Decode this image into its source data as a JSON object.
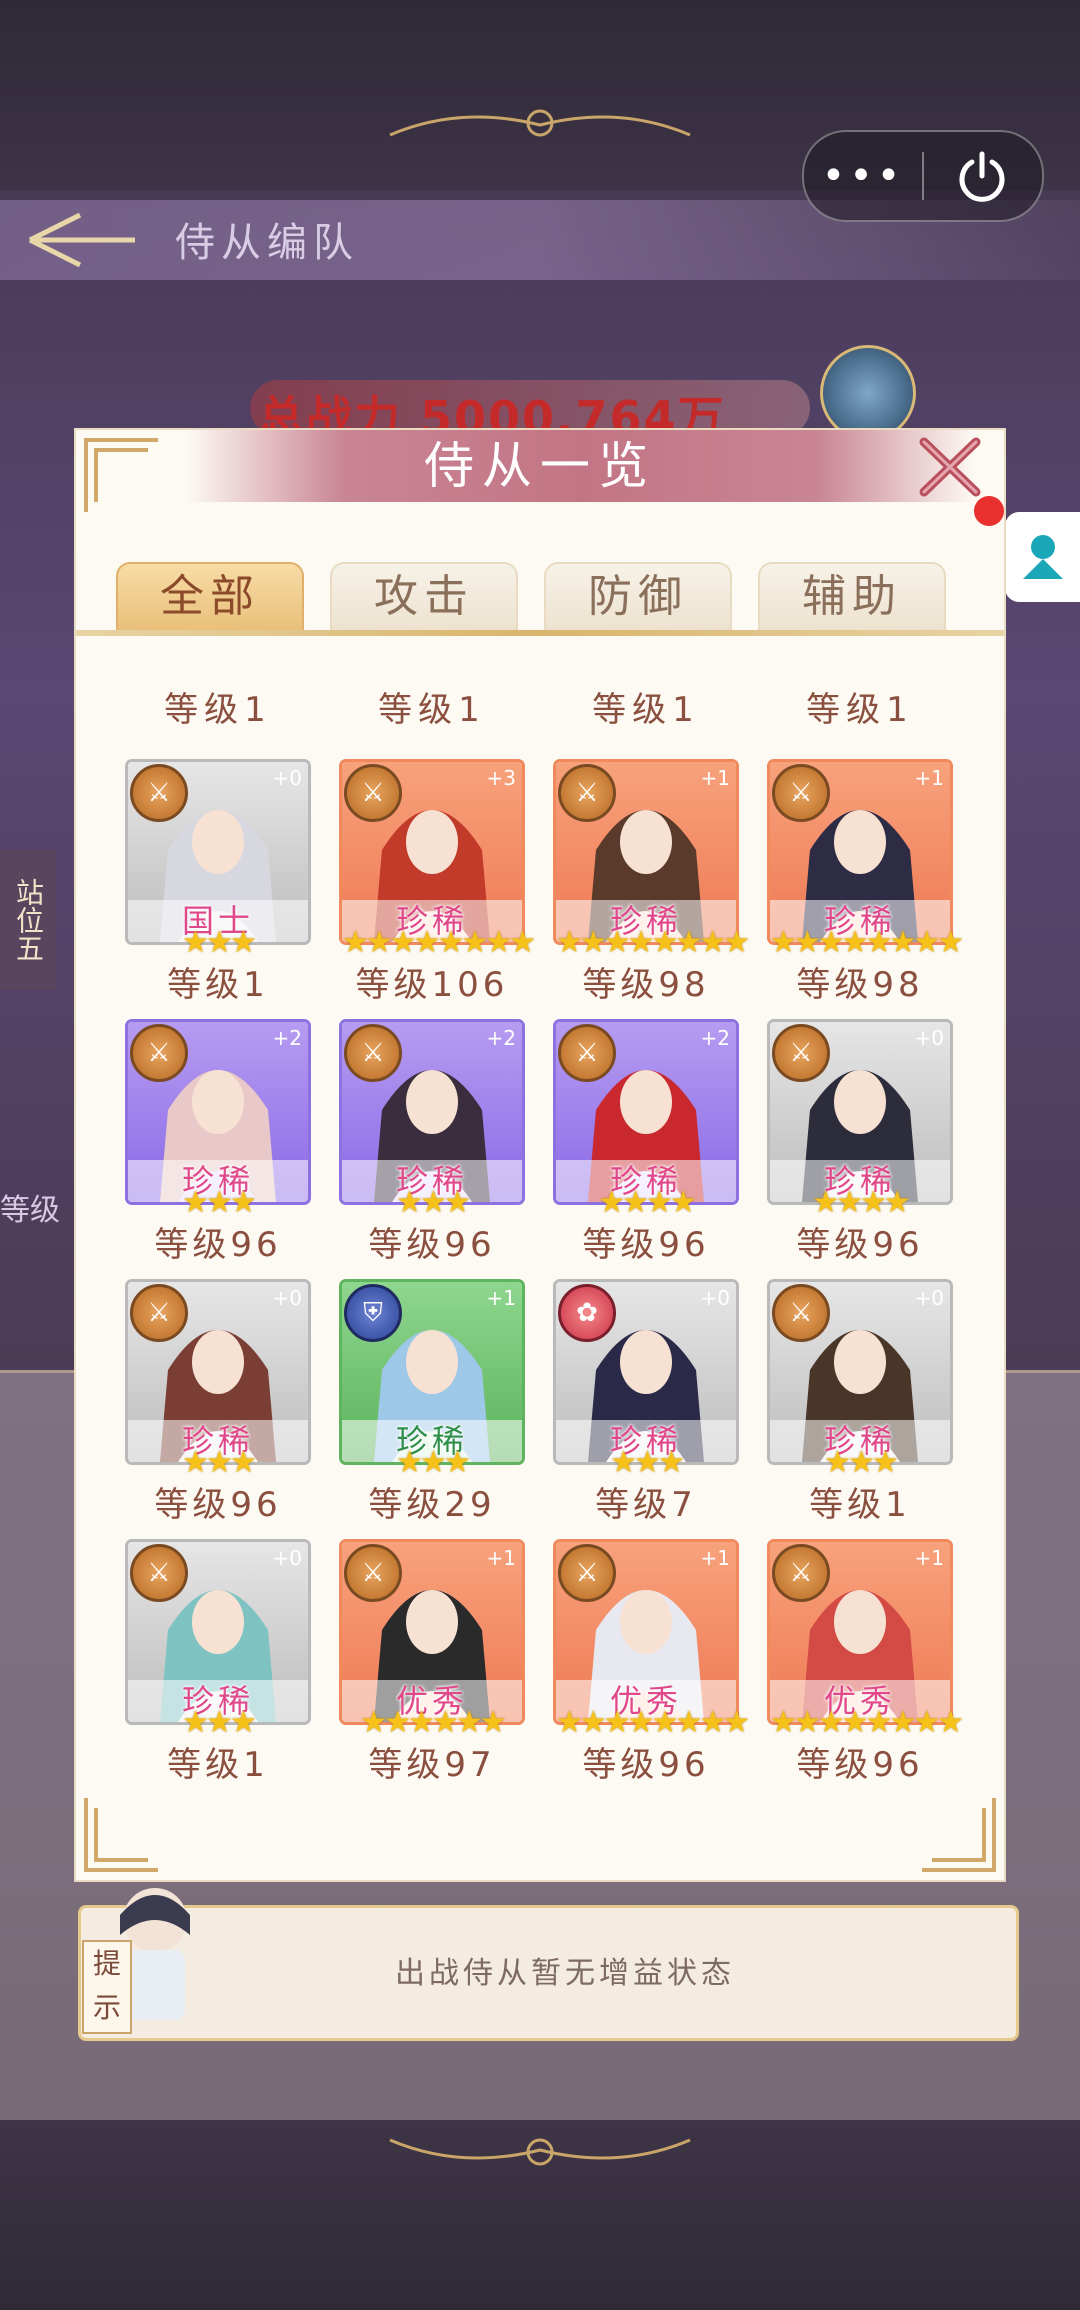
{
  "capsule": {
    "more_icon": "more-dots-icon",
    "power_icon": "power-icon"
  },
  "background": {
    "formation_title": "侍从编队",
    "total_power": "总战力 5000.764万",
    "side_label": "站位五",
    "left_level": "等级",
    "tip_tag": "提示",
    "tip_text": "出战侍从暂无增益状态"
  },
  "modal": {
    "title": "侍从一览",
    "tabs": [
      {
        "label": "全部",
        "active": true
      },
      {
        "label": "攻击",
        "active": false
      },
      {
        "label": "防御",
        "active": false
      },
      {
        "label": "辅助",
        "active": false
      }
    ],
    "top_levels": [
      "等级1",
      "等级1",
      "等级1",
      "等级1"
    ],
    "cards": [
      {
        "frame": "gray",
        "type": "sword",
        "plus": "+0",
        "rarity": "国士",
        "stars": "★★★",
        "level": "等级1"
      },
      {
        "frame": "orange",
        "type": "sword",
        "plus": "+3",
        "rarity": "珍稀",
        "stars": "★★★★★★★★",
        "level": "等级106"
      },
      {
        "frame": "orange",
        "type": "sword",
        "plus": "+1",
        "rarity": "珍稀",
        "stars": "★★★★★★★★",
        "level": "等级98"
      },
      {
        "frame": "orange",
        "type": "sword",
        "plus": "+1",
        "rarity": "珍稀",
        "stars": "★★★★★★★★",
        "level": "等级98"
      },
      {
        "frame": "purple",
        "type": "sword",
        "plus": "+2",
        "rarity": "珍稀",
        "stars": "★★★",
        "level": "等级96"
      },
      {
        "frame": "purple",
        "type": "sword",
        "plus": "+2",
        "rarity": "珍稀",
        "stars": "★★★",
        "level": "等级96"
      },
      {
        "frame": "purple",
        "type": "sword",
        "plus": "+2",
        "rarity": "珍稀",
        "stars": "★★★★",
        "level": "等级96"
      },
      {
        "frame": "gray",
        "type": "sword",
        "plus": "+0",
        "rarity": "珍稀",
        "stars": "★★★★",
        "level": "等级96"
      },
      {
        "frame": "gray",
        "type": "sword",
        "plus": "+0",
        "rarity": "珍稀",
        "stars": "★★★",
        "level": "等级96"
      },
      {
        "frame": "green",
        "type": "shield",
        "plus": "+1",
        "rarity": "珍稀",
        "stars": "★★★",
        "level": "等级29"
      },
      {
        "frame": "gray",
        "type": "lotus",
        "plus": "+0",
        "rarity": "珍稀",
        "stars": "★★★",
        "level": "等级7"
      },
      {
        "frame": "gray",
        "type": "sword",
        "plus": "+0",
        "rarity": "珍稀",
        "stars": "★★★",
        "level": "等级1"
      },
      {
        "frame": "gray",
        "type": "sword",
        "plus": "+0",
        "rarity": "珍稀",
        "stars": "★★★",
        "level": "等级1"
      },
      {
        "frame": "orange",
        "type": "sword",
        "plus": "+1",
        "rarity": "优秀",
        "stars": "★★★★★★",
        "level": "等级97"
      },
      {
        "frame": "orange",
        "type": "sword",
        "plus": "+1",
        "rarity": "优秀",
        "stars": "★★★★★★★★",
        "level": "等级96"
      },
      {
        "frame": "orange",
        "type": "sword",
        "plus": "+1",
        "rarity": "优秀",
        "stars": "★★★★★★★★",
        "level": "等级96"
      }
    ]
  }
}
